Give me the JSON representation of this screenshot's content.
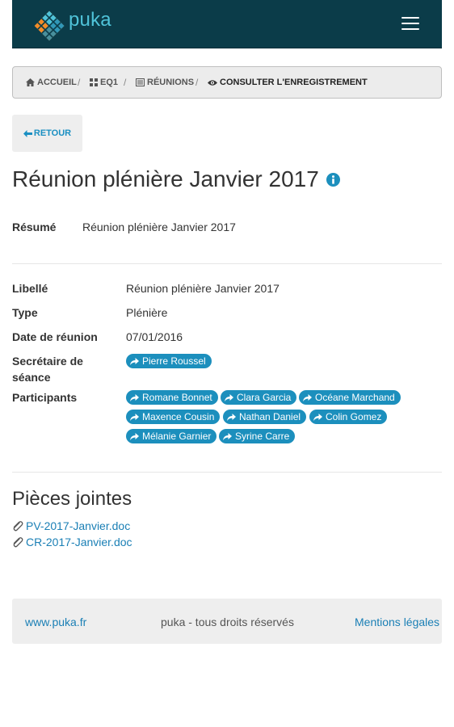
{
  "brand": {
    "name": "puka",
    "logo_icon": "puka-logo-icon"
  },
  "nav": {
    "menu_icon": "hamburger-menu-icon"
  },
  "breadcrumb": [
    {
      "label": "ACCUEIL",
      "icon": "home-icon"
    },
    {
      "label": "EQ1",
      "icon": "grid-icon"
    },
    {
      "label": "RÉUNIONS",
      "icon": "list-icon"
    },
    {
      "label": "CONSULTER L'ENREGISTREMENT",
      "icon": "eye-icon"
    }
  ],
  "back_button": {
    "label": "RETOUR",
    "icon": "arrow-left-icon"
  },
  "title": "Réunion plénière Janvier 2017",
  "summary": {
    "label": "Résumé",
    "value": "Réunion plénière Janvier 2017"
  },
  "details": {
    "libelle": {
      "label": "Libellé",
      "value": "Réunion plénière Janvier 2017"
    },
    "type": {
      "label": "Type",
      "value": "Plénière"
    },
    "date": {
      "label": "Date de réunion",
      "value": "07/01/2016"
    },
    "secretary": {
      "label_line1": "Secrétaire de",
      "label_line2": "séance",
      "people": [
        "Pierre Roussel"
      ]
    },
    "participants": {
      "label": "Participants",
      "people": [
        "Romane Bonnet",
        "Clara Garcia",
        "Océane Marchand",
        "Maxence Cousin",
        "Nathan Daniel",
        "Colin Gomez",
        "Mélanie Garnier",
        "Syrine Carre"
      ]
    }
  },
  "attachments": {
    "title": "Pièces jointes",
    "files": [
      "PV-2017-Janvier.doc",
      "CR-2017-Janvier.doc"
    ]
  },
  "footer": {
    "site": "www.puka.fr",
    "rights": "puka - tous droits réservés",
    "legal": "Mentions légales"
  },
  "colors": {
    "navbar": "#0b3c49",
    "brand": "#4fc3d9",
    "accent": "#1c8fbd",
    "link": "#1a7fb5"
  }
}
